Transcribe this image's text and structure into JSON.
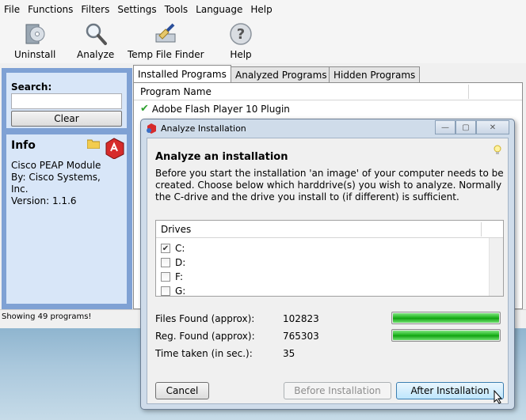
{
  "menu": [
    "File",
    "Functions",
    "Filters",
    "Settings",
    "Tools",
    "Language",
    "Help"
  ],
  "toolbar": {
    "uninstall": "Uninstall",
    "analyze": "Analyze",
    "temp": "Temp File Finder",
    "help": "Help"
  },
  "sidebar": {
    "search_title": "Search:",
    "search_value": "",
    "clear": "Clear",
    "info_title": "Info",
    "info_lines": [
      "Cisco PEAP Module",
      "By: Cisco Systems,",
      "Inc.",
      "Version: 1.1.6"
    ]
  },
  "tabs": [
    "Installed Programs",
    "Analyzed Programs",
    "Hidden Programs"
  ],
  "list": {
    "header": "Program Name",
    "rows": [
      "Adobe Flash Player 10 Plugin"
    ]
  },
  "status": "Showing 49 programs!",
  "dialog": {
    "title": "Analyze Installation",
    "heading": "Analyze an installation",
    "text": "Before you start the installation 'an image' of your computer needs to be created. Choose below which harddrive(s) you wish to analyze. Normally the C-drive and the drive you install to (if different) is sufficient.",
    "drives_header": "Drives",
    "drives": [
      {
        "label": "C:",
        "checked": true
      },
      {
        "label": "D:",
        "checked": false
      },
      {
        "label": "F:",
        "checked": false
      },
      {
        "label": "G:",
        "checked": false
      }
    ],
    "files_label": "Files Found (approx):",
    "files_value": "102823",
    "files_progress": 1.0,
    "reg_label": "Reg. Found (approx):",
    "reg_value": "765303",
    "reg_progress": 1.0,
    "time_label": "Time taken (in sec.):",
    "time_value": "35",
    "cancel": "Cancel",
    "before": "Before Installation",
    "after": "After Installation"
  }
}
